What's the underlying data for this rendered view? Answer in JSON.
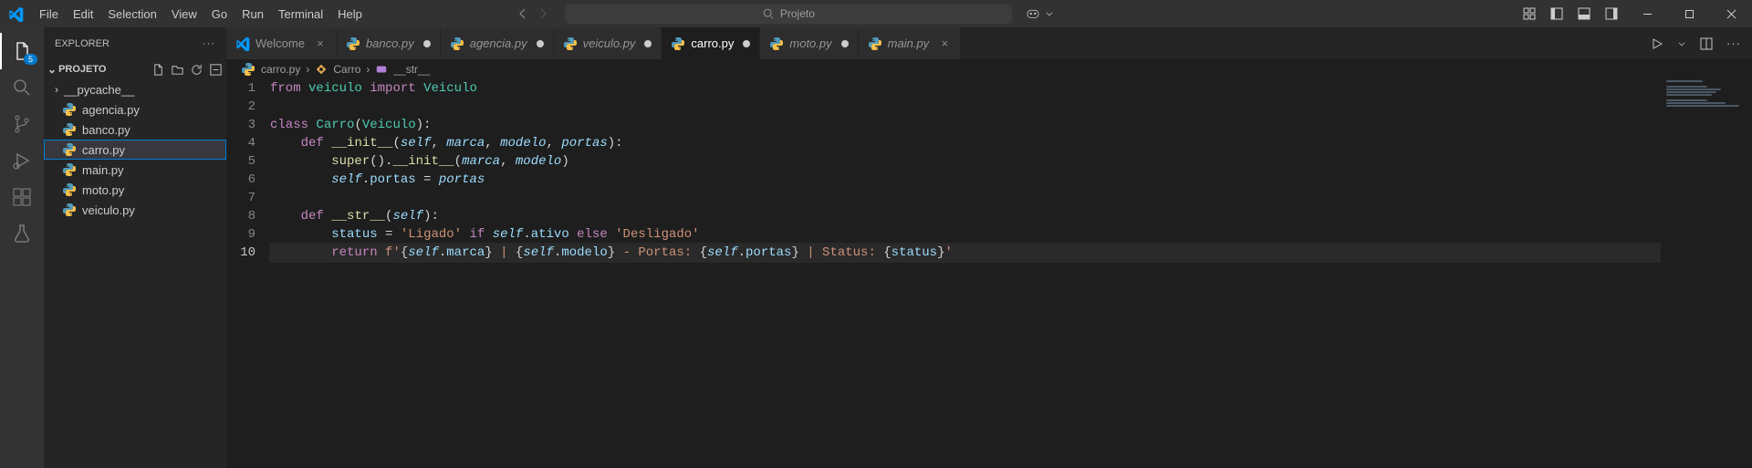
{
  "menu": [
    "File",
    "Edit",
    "Selection",
    "View",
    "Go",
    "Run",
    "Terminal",
    "Help"
  ],
  "search_placeholder": "Projeto",
  "explorer_title": "EXPLORER",
  "project_name": "PROJETO",
  "filetree": {
    "folder": "__pycache__",
    "files": [
      "agencia.py",
      "banco.py",
      "carro.py",
      "main.py",
      "moto.py",
      "veiculo.py"
    ],
    "active": "carro.py"
  },
  "activity_badge": "5",
  "tabs": [
    {
      "label": "Welcome",
      "icon": "vscode",
      "dirty": false,
      "active": false,
      "italic": false
    },
    {
      "label": "banco.py",
      "icon": "py",
      "dirty": true,
      "active": false,
      "italic": true
    },
    {
      "label": "agencia.py",
      "icon": "py",
      "dirty": true,
      "active": false,
      "italic": true
    },
    {
      "label": "veiculo.py",
      "icon": "py",
      "dirty": true,
      "active": false,
      "italic": true
    },
    {
      "label": "carro.py",
      "icon": "py",
      "dirty": true,
      "active": true,
      "italic": false
    },
    {
      "label": "moto.py",
      "icon": "py",
      "dirty": true,
      "active": false,
      "italic": true
    },
    {
      "label": "main.py",
      "icon": "py",
      "dirty": false,
      "active": false,
      "italic": true
    }
  ],
  "breadcrumbs": [
    "carro.py",
    "Carro",
    "__str__"
  ],
  "code_lines": [
    {
      "n": 1,
      "seg": [
        [
          "kw",
          "from"
        ],
        [
          "pun",
          " "
        ],
        [
          "cls",
          "veiculo"
        ],
        [
          "pun",
          " "
        ],
        [
          "kw",
          "import"
        ],
        [
          "pun",
          " "
        ],
        [
          "cls",
          "Veiculo"
        ]
      ]
    },
    {
      "n": 2,
      "seg": []
    },
    {
      "n": 3,
      "seg": [
        [
          "kw",
          "class"
        ],
        [
          "pun",
          " "
        ],
        [
          "cls",
          "Carro"
        ],
        [
          "pun",
          "("
        ],
        [
          "cls",
          "Veiculo"
        ],
        [
          "pun",
          "):"
        ]
      ]
    },
    {
      "n": 4,
      "seg": [
        [
          "pun",
          "    "
        ],
        [
          "kw",
          "def"
        ],
        [
          "pun",
          " "
        ],
        [
          "fn",
          "__init__"
        ],
        [
          "pun",
          "("
        ],
        [
          "self",
          "self"
        ],
        [
          "pun",
          ", "
        ],
        [
          "par",
          "marca"
        ],
        [
          "pun",
          ", "
        ],
        [
          "par",
          "modelo"
        ],
        [
          "pun",
          ", "
        ],
        [
          "par",
          "portas"
        ],
        [
          "pun",
          "):"
        ]
      ]
    },
    {
      "n": 5,
      "seg": [
        [
          "pun",
          "        "
        ],
        [
          "fn",
          "super"
        ],
        [
          "pun",
          "()."
        ],
        [
          "fn",
          "__init__"
        ],
        [
          "pun",
          "("
        ],
        [
          "par",
          "marca"
        ],
        [
          "pun",
          ", "
        ],
        [
          "par",
          "modelo"
        ],
        [
          "pun",
          ")"
        ]
      ]
    },
    {
      "n": 6,
      "seg": [
        [
          "pun",
          "        "
        ],
        [
          "self",
          "self"
        ],
        [
          "pun",
          "."
        ],
        [
          "prop",
          "portas"
        ],
        [
          "pun",
          " = "
        ],
        [
          "par",
          "portas"
        ]
      ]
    },
    {
      "n": 7,
      "seg": []
    },
    {
      "n": 8,
      "seg": [
        [
          "pun",
          "    "
        ],
        [
          "kw",
          "def"
        ],
        [
          "pun",
          " "
        ],
        [
          "fn",
          "__str__"
        ],
        [
          "pun",
          "("
        ],
        [
          "self",
          "self"
        ],
        [
          "pun",
          "):"
        ]
      ]
    },
    {
      "n": 9,
      "seg": [
        [
          "pun",
          "        "
        ],
        [
          "prop",
          "status"
        ],
        [
          "pun",
          " = "
        ],
        [
          "str",
          "'Ligado'"
        ],
        [
          "pun",
          " "
        ],
        [
          "kw",
          "if"
        ],
        [
          "pun",
          " "
        ],
        [
          "self",
          "self"
        ],
        [
          "pun",
          "."
        ],
        [
          "prop",
          "ativo"
        ],
        [
          "pun",
          " "
        ],
        [
          "kw",
          "else"
        ],
        [
          "pun",
          " "
        ],
        [
          "str",
          "'Desligado'"
        ]
      ]
    },
    {
      "n": 10,
      "cur": true,
      "seg": [
        [
          "pun",
          "        "
        ],
        [
          "kw",
          "return"
        ],
        [
          "pun",
          " "
        ],
        [
          "str",
          "f'"
        ],
        [
          "pun",
          "{"
        ],
        [
          "self",
          "self"
        ],
        [
          "pun",
          "."
        ],
        [
          "prop",
          "marca"
        ],
        [
          "pun",
          "}"
        ],
        [
          "str",
          " | "
        ],
        [
          "pun",
          "{"
        ],
        [
          "self",
          "self"
        ],
        [
          "pun",
          "."
        ],
        [
          "prop",
          "modelo"
        ],
        [
          "pun",
          "}"
        ],
        [
          "str",
          " - Portas: "
        ],
        [
          "pun",
          "{"
        ],
        [
          "self",
          "self"
        ],
        [
          "pun",
          "."
        ],
        [
          "prop",
          "portas"
        ],
        [
          "pun",
          "}"
        ],
        [
          "str",
          " | Status: "
        ],
        [
          "pun",
          "{"
        ],
        [
          "prop",
          "status"
        ],
        [
          "pun",
          "}"
        ],
        [
          "str",
          "'"
        ]
      ]
    }
  ]
}
